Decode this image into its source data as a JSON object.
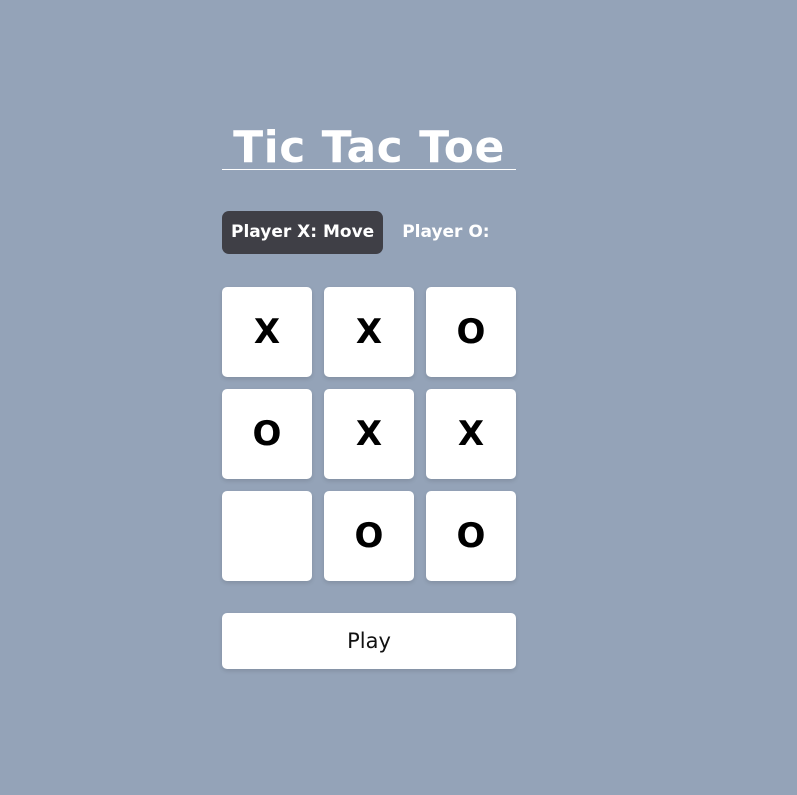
{
  "title": "Tic Tac Toe",
  "players": {
    "x": {
      "label": "Player X:",
      "status": "Move",
      "active": true
    },
    "o": {
      "label": "Player O:",
      "status": "",
      "active": false
    }
  },
  "board": {
    "cells": [
      "X",
      "X",
      "O",
      "O",
      "X",
      "X",
      "",
      "O",
      "O"
    ]
  },
  "play_button": {
    "label": "Play"
  },
  "colors": {
    "background": "#94a3b8",
    "active_player": "#3f3f46",
    "cell": "#ffffff",
    "mark": "#000000"
  }
}
